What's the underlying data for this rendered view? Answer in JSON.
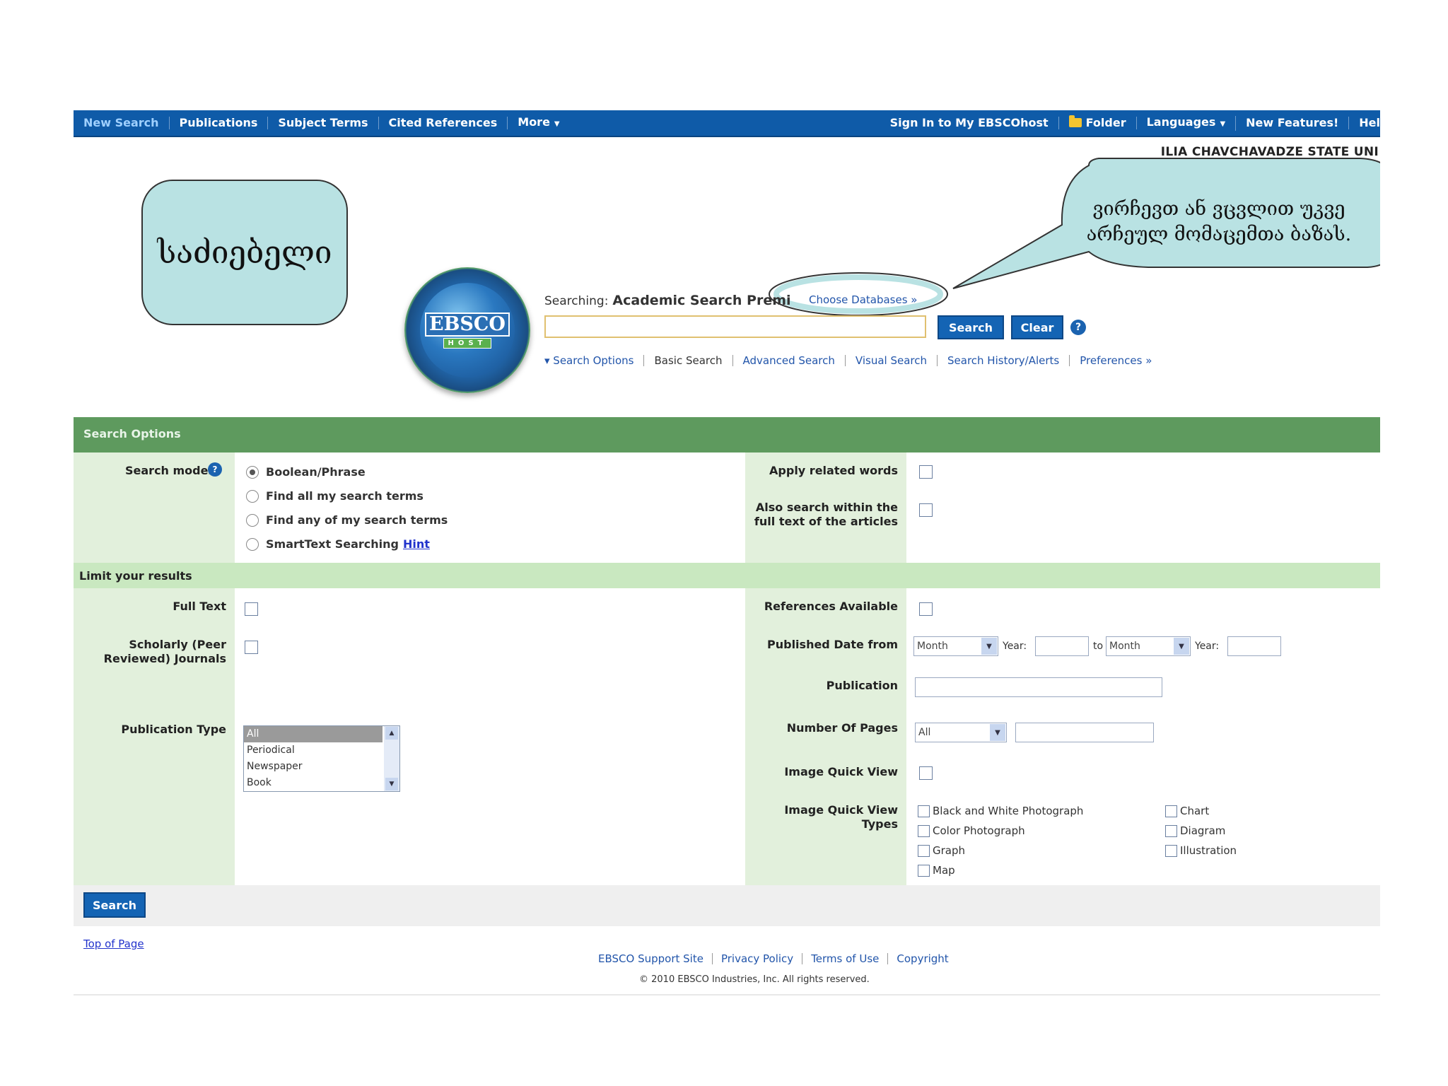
{
  "topnav": {
    "left": [
      "New Search",
      "Publications",
      "Subject Terms",
      "Cited References",
      "More"
    ],
    "signin": "Sign In to My EBSCOhost",
    "folder": "Folder",
    "languages": "Languages",
    "new_features": "New Features!",
    "help": "Hel"
  },
  "institution": "ILIA CHAVCHAVADZE STATE UNI",
  "callouts": {
    "left": "საძიებელი",
    "right": "ვირჩევთ ან ვცვლით უკვე არჩეულ მომაცემთა ბაზას."
  },
  "logo": {
    "word": "EBSCO",
    "sub": "HOST"
  },
  "search": {
    "searching_label": "Searching:",
    "database": "Academic Search Premi",
    "choose_db": "Choose Databases »",
    "query_value": "",
    "search_btn": "Search",
    "clear_btn": "Clear",
    "help": "?",
    "links": [
      "▾ Search Options",
      "Basic Search",
      "Advanced Search",
      "Visual Search",
      "Search History/Alerts",
      "Preferences »"
    ]
  },
  "options": {
    "header": "Search Options",
    "modes_label": "Search modes",
    "modes": [
      "Boolean/Phrase",
      "Find all my search terms",
      "Find any of my search terms",
      "SmartText Searching"
    ],
    "hint": "Hint",
    "apply_related": "Apply related words",
    "also_search_1": "Also search within the",
    "also_search_2": "full text of the articles"
  },
  "limits": {
    "header": "Limit your results",
    "full_text": "Full Text",
    "scholarly_1": "Scholarly (Peer",
    "scholarly_2": "Reviewed) Journals",
    "pub_type": "Publication Type",
    "pub_type_options": [
      "All",
      "Periodical",
      "Newspaper",
      "Book"
    ],
    "references": "References Available",
    "pub_date": "Published Date from",
    "month": "Month",
    "year": "Year:",
    "to": "to",
    "publication": "Publication",
    "num_pages": "Number Of Pages",
    "num_pages_value": "All",
    "image_qv": "Image Quick View",
    "image_qv_types": "Image Quick View Types",
    "types_col1": [
      "Black and White Photograph",
      "Color Photograph",
      "Graph",
      "Map"
    ],
    "types_col2": [
      "Chart",
      "Diagram",
      "Illustration"
    ]
  },
  "bottom": {
    "search_btn": "Search",
    "top_of_page": "Top of Page",
    "footer_links": [
      "EBSCO Support Site",
      "Privacy Policy",
      "Terms of Use",
      "Copyright"
    ],
    "copyright": "© 2010 EBSCO Industries, Inc. All rights reserved."
  },
  "colors": {
    "nav": "#0f5ba8",
    "panel_header": "#5e9a5e",
    "label_bg": "#e2f0dc",
    "limit_bg": "#c9e8c0",
    "callout": "#b9e2e3"
  }
}
